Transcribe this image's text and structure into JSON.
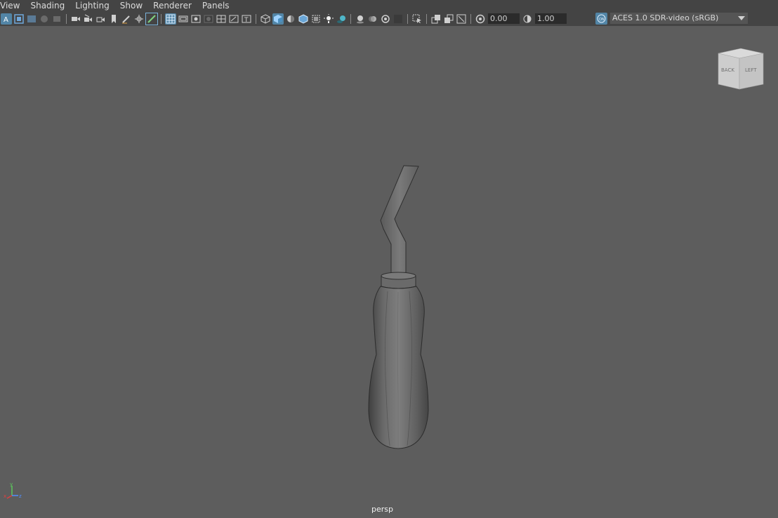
{
  "menubar": {
    "items": [
      "View",
      "Shading",
      "Lighting",
      "Show",
      "Renderer",
      "Panels"
    ]
  },
  "toolbar": {
    "exposure_value": "0.00",
    "gamma_value": "1.00",
    "color_space": "ACES 1.0 SDR-video (sRGB)",
    "icons": [
      "select-camera-icon",
      "camera-attributes-icon",
      "bookmarks-icon",
      "image-plane-icon",
      "two-d-pan-icon",
      "grease-pencil-icon",
      "grid-icon",
      "film-gate-icon",
      "resolution-gate-icon",
      "gate-mask-icon",
      "field-chart-icon",
      "safe-action-icon",
      "safe-title-icon",
      "wireframe-icon",
      "smooth-shade-icon",
      "use-default-material-icon",
      "wireframe-on-shaded-icon",
      "xray-icon",
      "textured-icon",
      "use-all-lights-icon",
      "shadows-icon",
      "screen-space-ao-icon",
      "motion-blur-icon",
      "multisample-aa-icon",
      "depth-of-field-icon",
      "isolate-select-icon",
      "xray-joints-icon",
      "xray-active-components-icon",
      "exposure-icon",
      "gamma-icon",
      "view-transform-icon"
    ]
  },
  "viewcube": {
    "back_label": "BACK",
    "left_label": "LEFT"
  },
  "viewport": {
    "camera_name": "persp",
    "axis_labels": {
      "x": "x",
      "y": "y",
      "z": "z"
    }
  },
  "colors": {
    "viewport_bg": "#5d5d5d",
    "toolbar_bg": "#444444",
    "active_blue": "#5285a6",
    "axis_x": "#e04040",
    "axis_y": "#5cc85c",
    "axis_z": "#5090ff"
  }
}
